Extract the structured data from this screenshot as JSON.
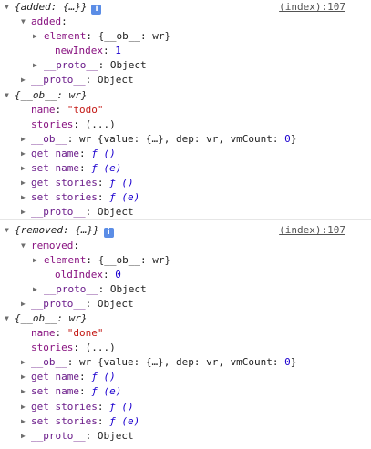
{
  "entries": [
    {
      "summary": "{added: {…}}",
      "source": "(index):107",
      "key": "added",
      "element": "{__ob__: wr}",
      "index_key": "newIndex",
      "index_value": "1",
      "proto_inner": "Object",
      "proto_outer": "Object",
      "ob_summary": "{__ob__: wr}",
      "name_value": "\"todo\"",
      "stories_value": "(...)",
      "ob_detail_prefix": "wr {value: {…}, dep: vr, vmCount: ",
      "ob_detail_count": "0",
      "ob_detail_suffix": "}",
      "get_name": "get name",
      "set_name": "set name",
      "get_stories": "get stories",
      "set_stories": "set stories",
      "getter_sig": "ƒ ()",
      "setter_sig": "ƒ (e)",
      "proto_last": "Object"
    },
    {
      "summary": "{removed: {…}}",
      "source": "(index):107",
      "key": "removed",
      "element": "{__ob__: wr}",
      "index_key": "oldIndex",
      "index_value": "0",
      "proto_inner": "Object",
      "proto_outer": "Object",
      "ob_summary": "{__ob__: wr}",
      "name_value": "\"done\"",
      "stories_value": "(...)",
      "ob_detail_prefix": "wr {value: {…}, dep: vr, vmCount: ",
      "ob_detail_count": "0",
      "ob_detail_suffix": "}",
      "get_name": "get name",
      "set_name": "set name",
      "get_stories": "get stories",
      "set_stories": "set stories",
      "getter_sig": "ƒ ()",
      "setter_sig": "ƒ (e)",
      "proto_last": "Object"
    }
  ],
  "labels": {
    "element": "element",
    "proto": "__proto__",
    "ob": "__ob__",
    "name": "name",
    "stories": "stories",
    "info_badge": "i"
  },
  "colors": {
    "key": "#881280",
    "string": "#c41a16",
    "number": "#1c00cf",
    "badge": "#5b8de6"
  }
}
